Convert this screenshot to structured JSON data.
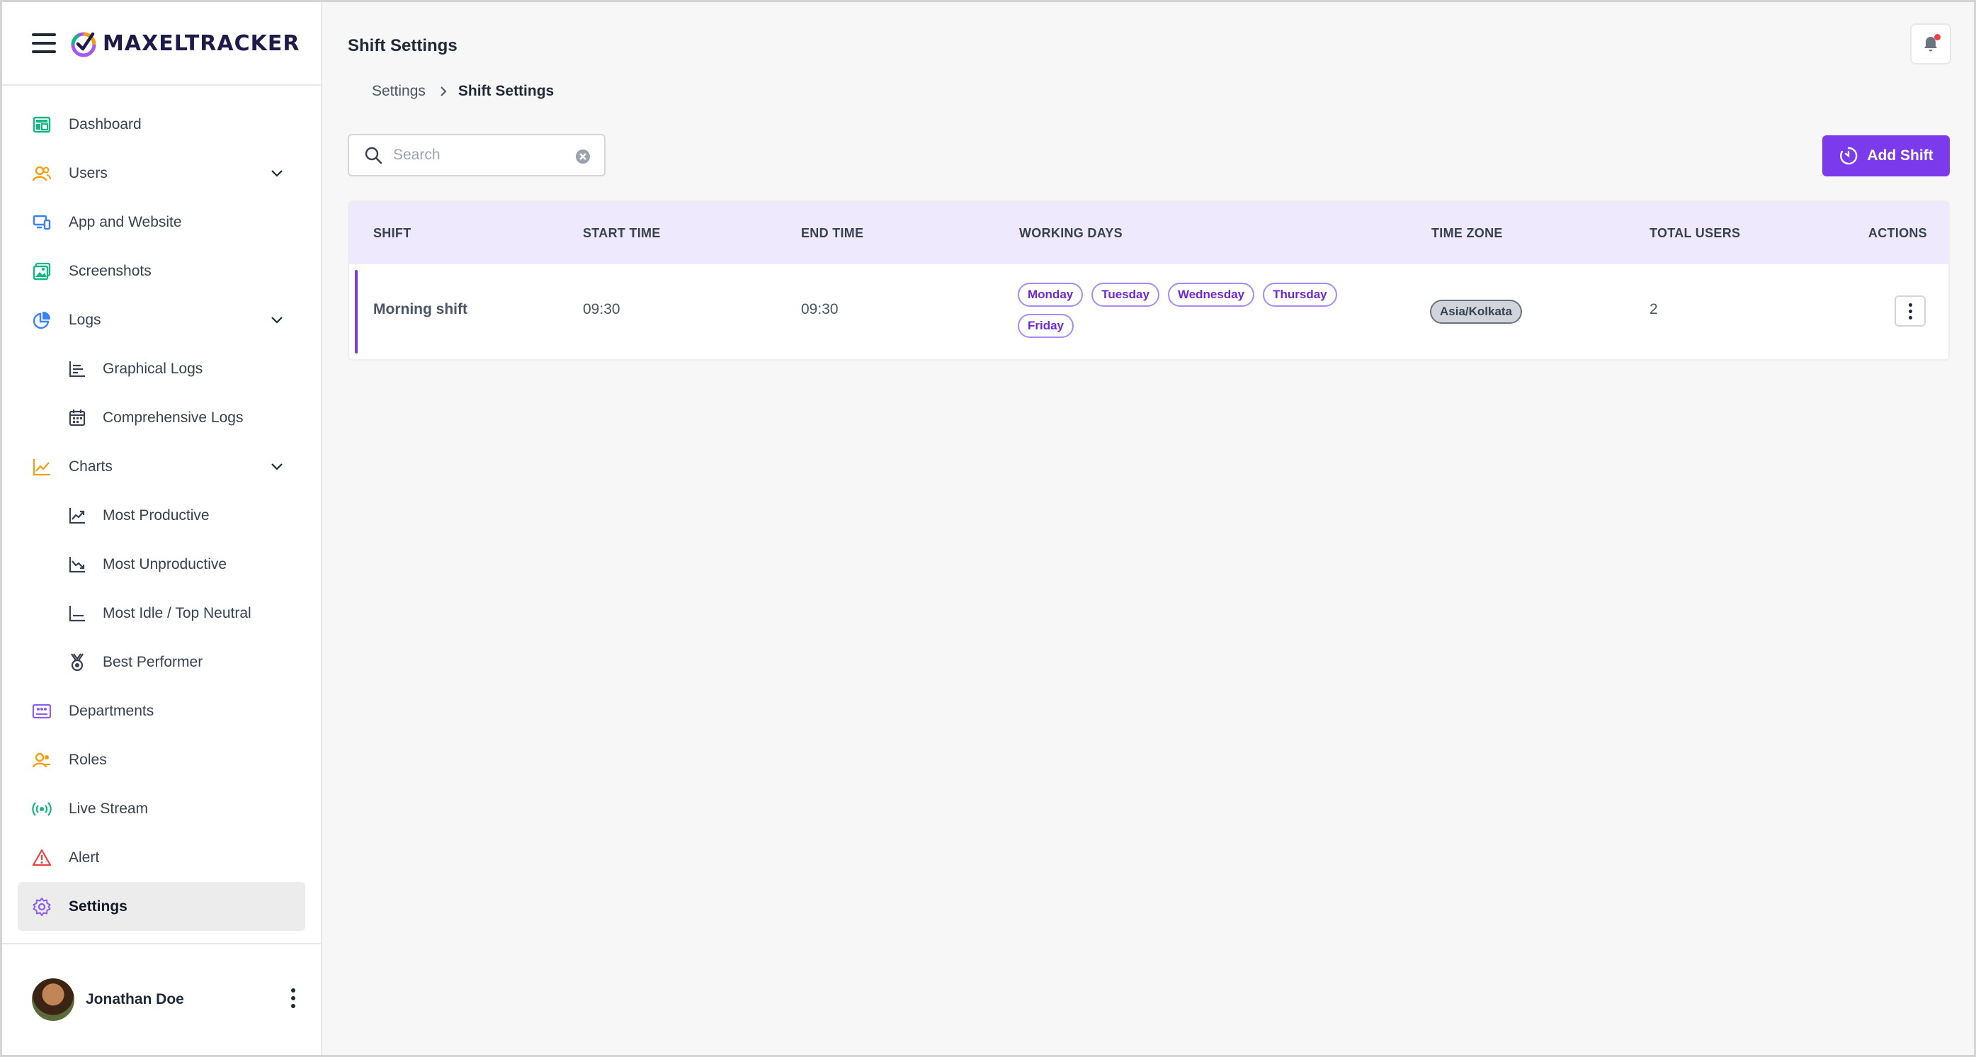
{
  "brand": {
    "name": "MAXELTRACKER"
  },
  "sidebar": {
    "items": [
      {
        "label": "Dashboard",
        "icon": "dashboard-icon",
        "expandable": false
      },
      {
        "label": "Users",
        "icon": "users-icon",
        "expandable": true
      },
      {
        "label": "App and Website",
        "icon": "devices-icon",
        "expandable": false
      },
      {
        "label": "Screenshots",
        "icon": "image-icon",
        "expandable": false
      },
      {
        "label": "Logs",
        "icon": "pie-chart-icon",
        "expandable": true
      },
      {
        "label": "Graphical Logs",
        "icon": "bar-chart-icon",
        "sub": true
      },
      {
        "label": "Comprehensive Logs",
        "icon": "calendar-icon",
        "sub": true
      },
      {
        "label": "Charts",
        "icon": "line-chart-icon",
        "expandable": true
      },
      {
        "label": "Most Productive",
        "icon": "trend-up-icon",
        "sub": true
      },
      {
        "label": "Most Unproductive",
        "icon": "trend-down-icon",
        "sub": true
      },
      {
        "label": "Most Idle / Top Neutral",
        "icon": "trend-flat-icon",
        "sub": true
      },
      {
        "label": "Best Performer",
        "icon": "medal-icon",
        "sub": true
      },
      {
        "label": "Departments",
        "icon": "departments-icon",
        "expandable": false
      },
      {
        "label": "Roles",
        "icon": "roles-icon",
        "expandable": false
      },
      {
        "label": "Live Stream",
        "icon": "broadcast-icon",
        "expandable": false
      },
      {
        "label": "Alert",
        "icon": "alert-icon",
        "expandable": false
      },
      {
        "label": "Settings",
        "icon": "gear-icon",
        "expandable": false,
        "active": true
      }
    ],
    "user": {
      "name": "Jonathan Doe"
    }
  },
  "header": {
    "title": "Shift Settings"
  },
  "breadcrumb": {
    "parent": "Settings",
    "current": "Shift Settings"
  },
  "search": {
    "placeholder": "Search",
    "value": ""
  },
  "toolbar": {
    "add_label": "Add Shift"
  },
  "table": {
    "columns": [
      "SHIFT",
      "START TIME",
      "END TIME",
      "WORKING DAYS",
      "TIME ZONE",
      "TOTAL USERS",
      "ACTIONS"
    ],
    "rows": [
      {
        "shift": "Morning shift",
        "start_time": "09:30",
        "end_time": "09:30",
        "working_days": [
          "Monday",
          "Tuesday",
          "Wednesday",
          "Thursday",
          "Friday"
        ],
        "time_zone": "Asia/Kolkata",
        "total_users": "2"
      }
    ]
  },
  "colors": {
    "accent": "#7c3aed",
    "header_bg": "#efe9fd",
    "notification_dot": "#ef4444"
  }
}
